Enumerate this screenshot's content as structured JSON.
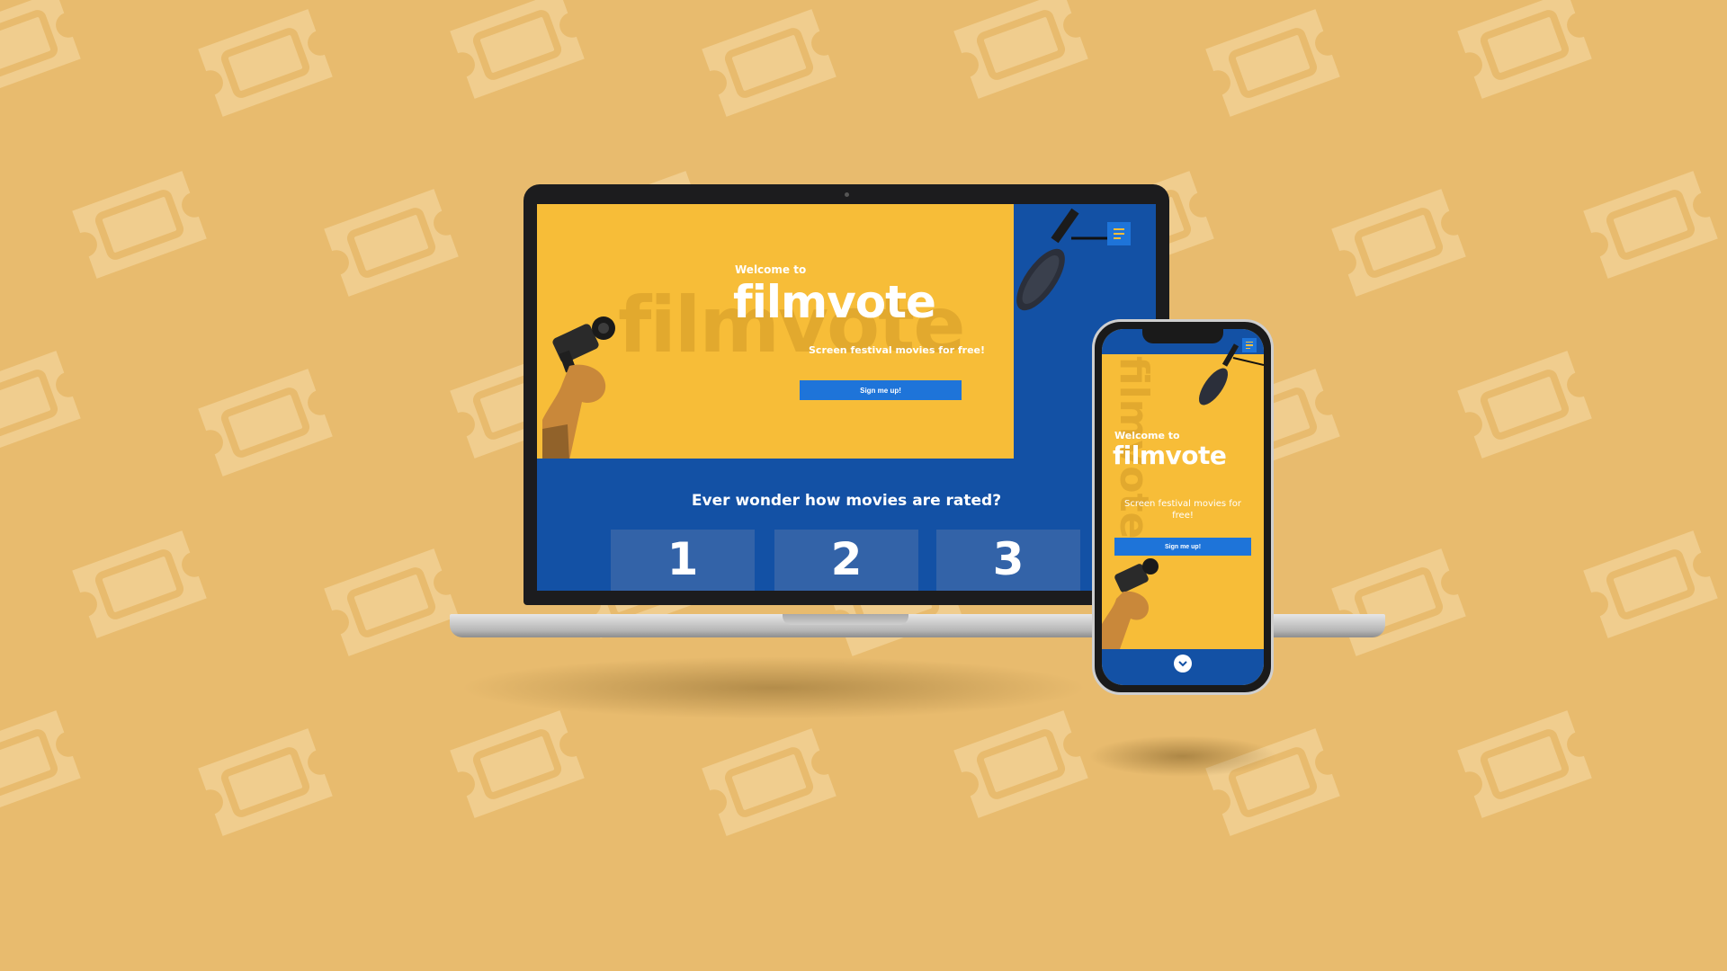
{
  "colors": {
    "background": "#E8BB6E",
    "ticket_pattern": "#F0CD8E",
    "hero_yellow": "#F7BD38",
    "brand_blue": "#1351A5",
    "button_blue": "#1E74D9",
    "card_blue": "#3363A8"
  },
  "icons": [
    "ticket-icon",
    "menu-icon",
    "video-camera-icon",
    "microphone-icon",
    "chevron-down-icon"
  ],
  "laptop": {
    "hero": {
      "watermark": "filmvote",
      "welcome": "Welcome to",
      "title": "filmvote",
      "tagline": "Screen festival movies for free!",
      "cta_label": "Sign me up!"
    },
    "section_title": "Ever wonder how movies are rated?",
    "steps": [
      "1",
      "2",
      "3"
    ]
  },
  "phone": {
    "watermark": "filmvote",
    "welcome": "Welcome to",
    "title": "filmvote",
    "tagline": "Screen festival movies for free!",
    "cta_label": "Sign me up!"
  }
}
